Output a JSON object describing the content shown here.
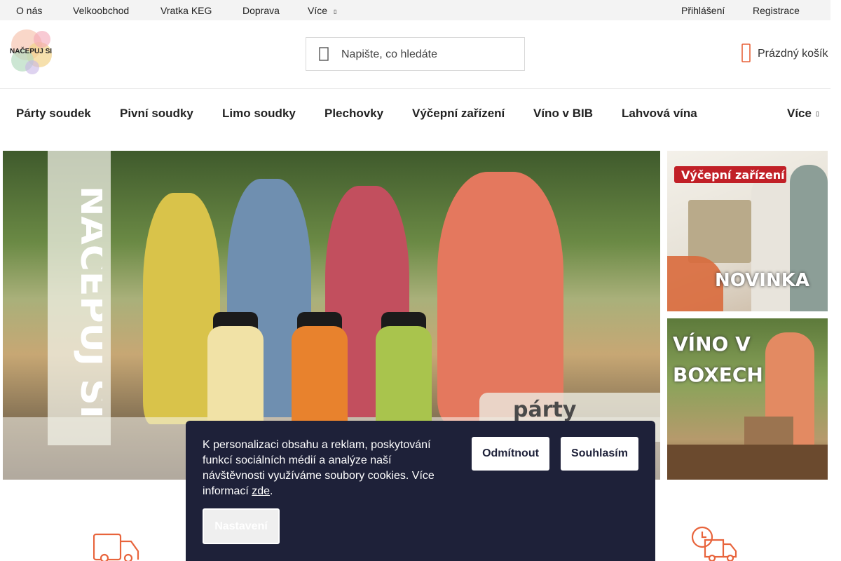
{
  "topbar": {
    "links": [
      "O nás",
      "Velkoobchod",
      "Vratka KEG",
      "Doprava",
      "Více"
    ],
    "login": "Přihlášení",
    "register": "Registrace"
  },
  "header": {
    "logo_text": "NAČEPUJ SI",
    "search_placeholder": "Napište, co hledáte",
    "cart_label": "Prázdný košík"
  },
  "nav": {
    "items": [
      "Párty soudek",
      "Pivní soudky",
      "Limo soudky",
      "Plechovky",
      "Výčepní zařízení",
      "Víno v BIB",
      "Lahvová vína"
    ],
    "more": "Více"
  },
  "banners": {
    "hero_vertical": "NAČEPUJ SI",
    "hero_tag": "párty soudky",
    "side1_badge": "Výčepní zařízení",
    "side1_label": "NOVINKA",
    "side2_line1": "VÍNO V",
    "side2_line2": "BOXECH"
  },
  "cookie": {
    "text": "K personalizaci obsahu a reklam, poskytování funkcí sociálních médií a analýze naší návštěvnosti využíváme soubory cookies. Více informací ",
    "link": "zde",
    "period": ".",
    "decline": "Odmítnout",
    "accept": "Souhlasím",
    "settings": "Nastavení"
  },
  "colors": {
    "accent": "#e8643c",
    "cookie_bg": "#1e2139",
    "topbar_bg": "#f3f3f3"
  }
}
